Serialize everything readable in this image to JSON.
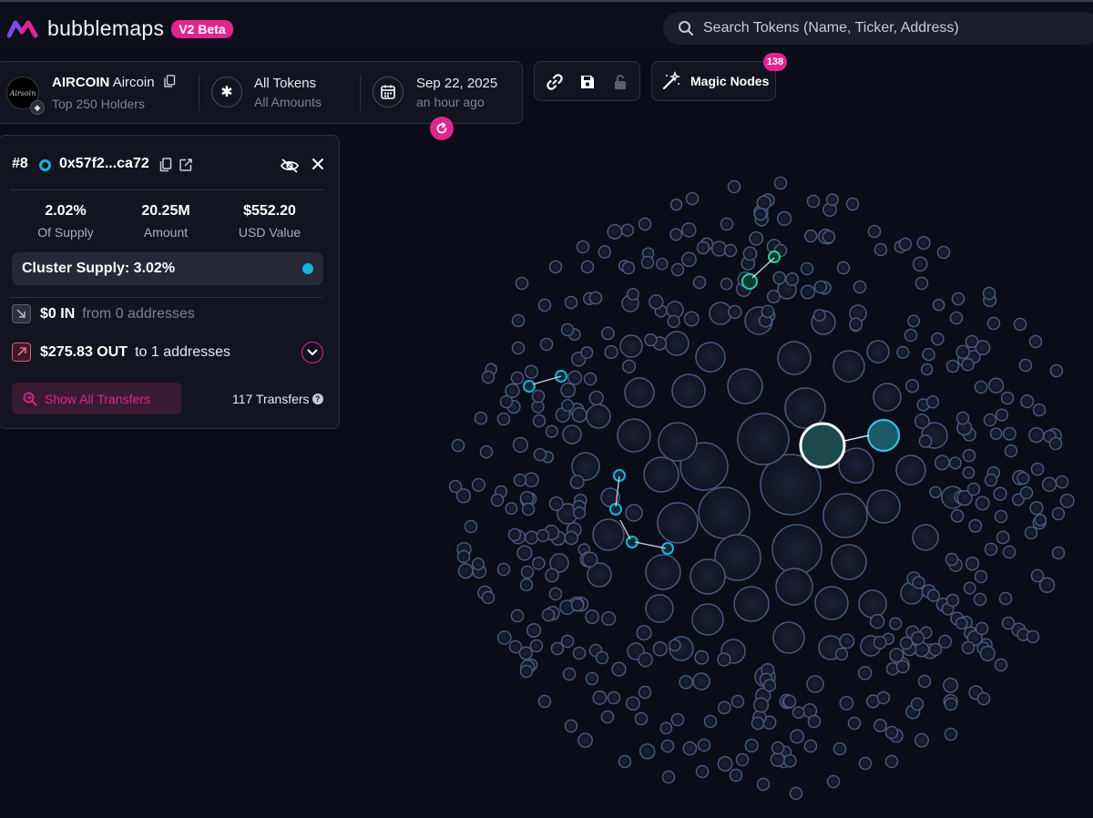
{
  "app": {
    "name": "bubblemaps",
    "badge": "V2 Beta",
    "search_placeholder": "Search Tokens (Name, Ticker, Address)"
  },
  "token": {
    "symbol": "AIRCOIN",
    "name": "Aircoin",
    "subtitle": "Top 250 Holders",
    "logo_text": "Airsoin"
  },
  "filter": {
    "title": "All Tokens",
    "subtitle": "All Amounts"
  },
  "date": {
    "title": "Sep 22, 2025",
    "subtitle": "an hour ago"
  },
  "magic_nodes": {
    "label": "Magic Nodes",
    "count": "138"
  },
  "wallet": {
    "rank": "#8",
    "address": "0x57f2...ca72",
    "stats": [
      {
        "value": "2.02%",
        "label": "Of Supply"
      },
      {
        "value": "20.25M",
        "label": "Amount"
      },
      {
        "value": "$552.20",
        "label": "USD Value"
      }
    ],
    "cluster_supply": "Cluster Supply: 3.02%",
    "inflow": {
      "amount": "$0 IN",
      "detail": "from 0 addresses"
    },
    "outflow": {
      "amount": "$275.83 OUT",
      "detail": "to 1 addresses"
    },
    "show_transfers_label": "Show All Transfers",
    "transfers_count": "117 Transfers"
  },
  "colors": {
    "accent": "#e0258e",
    "cluster": "#17b3da",
    "cluster_green": "#1dd3a0",
    "bubble_stroke": "#4a5880",
    "bubble_fill": "#101624"
  }
}
